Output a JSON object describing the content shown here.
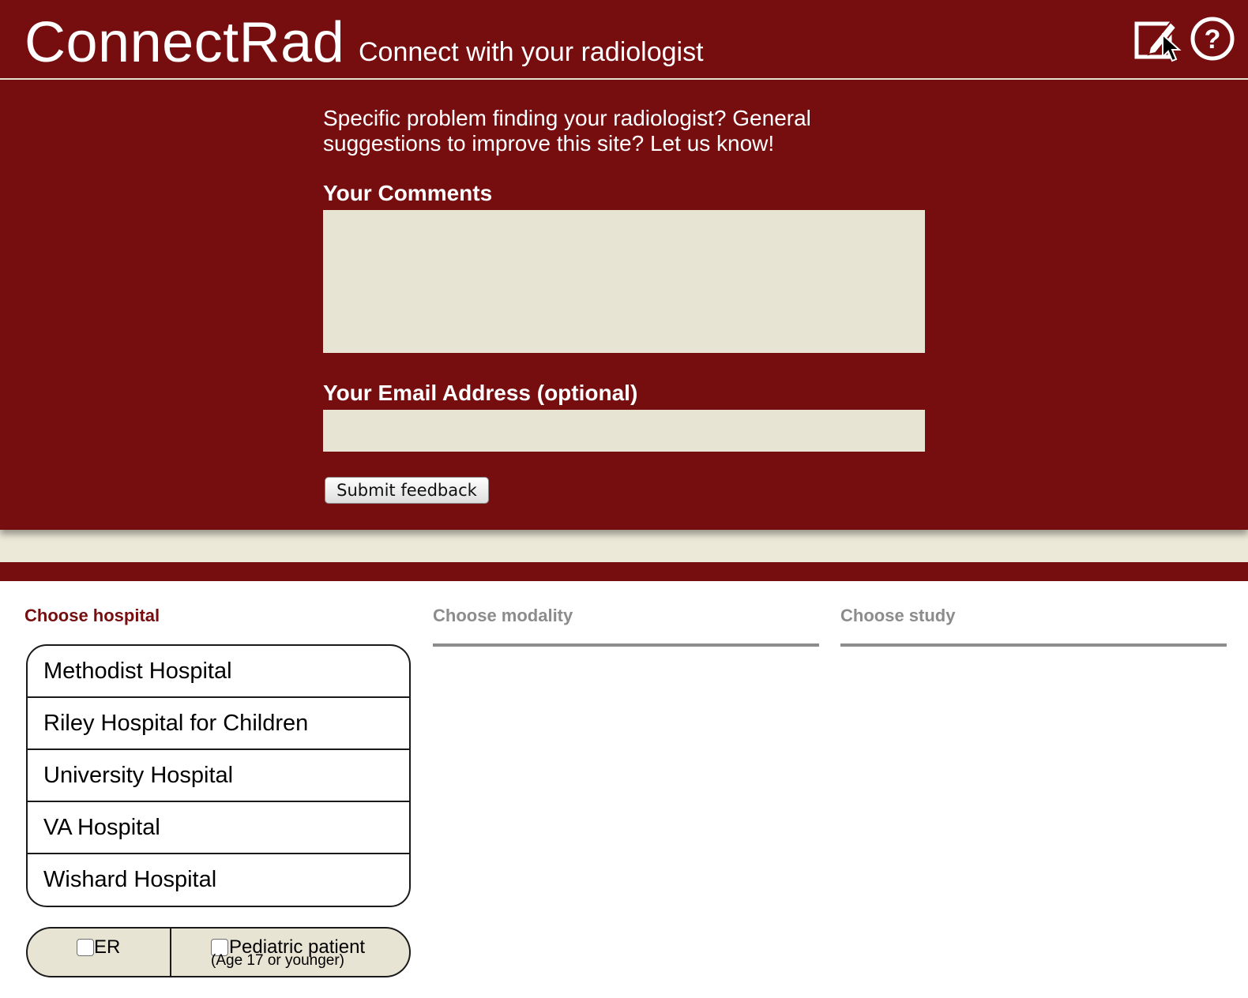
{
  "header": {
    "logo": "ConnectRad",
    "tagline": "Connect with your radiologist",
    "feedback_icon": "feedback-edit-icon",
    "help_icon": "help-icon"
  },
  "feedback_form": {
    "intro": "Specific problem finding your radiologist? General suggestions to improve this site? Let us know!",
    "comments_label": "Your Comments",
    "comments_value": "",
    "email_label": "Your Email Address (optional)",
    "email_value": "",
    "submit_label": "Submit feedback"
  },
  "columns": {
    "hospital": "Choose hospital",
    "modality": "Choose modality",
    "study": "Choose study"
  },
  "hospitals": [
    "Methodist Hospital",
    "Riley Hospital for Children",
    "University Hospital",
    "VA Hospital",
    "Wishard Hospital"
  ],
  "filters": {
    "er": {
      "label": "ER",
      "checked": false
    },
    "pediatric": {
      "label": "Pediatric patient",
      "sublabel": "(Age 17 or younger)",
      "checked": false
    }
  },
  "colors": {
    "brand": "#760e10",
    "cream": "#e8e4d4",
    "inactive": "#8c8c8c"
  }
}
